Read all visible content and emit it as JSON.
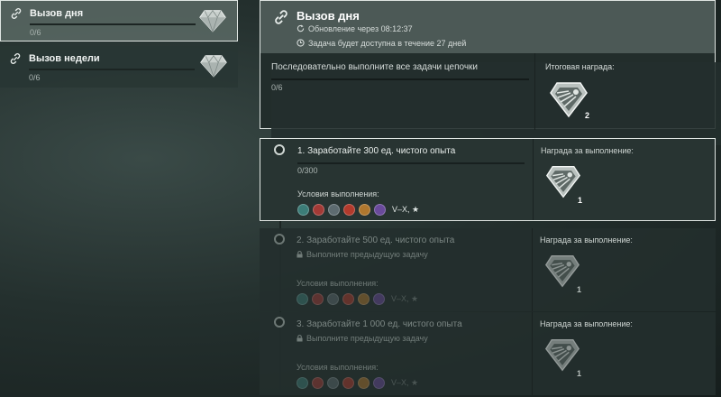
{
  "sidebar": {
    "cards": [
      {
        "title": "Вызов дня",
        "progress": "0/6",
        "selected": true
      },
      {
        "title": "Вызов недели",
        "progress": "0/6",
        "selected": false
      }
    ]
  },
  "header": {
    "title": "Вызов дня",
    "update": "Обновление через 08:12:37",
    "availability": "Задача будет доступна в течение 27 дней",
    "chain_text": "Последовательно выполните все задачи цепочки",
    "chain_progress": "0/6",
    "final_reward_label": "Итоговая награда:",
    "final_reward_count": "2"
  },
  "tasks": [
    {
      "title": "1. Заработайте 300 ед. чистого опыта",
      "progress": "0/300",
      "locked": false,
      "conditions_label": "Условия выполнения:",
      "tiers": "V–X, ★",
      "reward_label": "Награда за выполнение:",
      "reward_count": "1"
    },
    {
      "title": "2. Заработайте 500 ед. чистого опыта",
      "lock_text": "Выполните предыдущую задачу",
      "locked": true,
      "conditions_label": "Условия выполнения:",
      "tiers": "V–X, ★",
      "reward_label": "Награда за выполнение:",
      "reward_count": "1"
    },
    {
      "title": "3. Заработайте 1 000 ед. чистого опыта",
      "lock_text": "Выполните предыдущую задачу",
      "locked": true,
      "conditions_label": "Условия выполнения:",
      "tiers": "V–X, ★",
      "reward_label": "Награда за выполнение:",
      "reward_count": "1"
    }
  ],
  "condition_icons": [
    "destroyer-class-icon",
    "cruiser-class-icon",
    "battleship-class-icon",
    "aircraft-carrier-class-icon",
    "submarine-class-icon",
    "special-class-icon"
  ],
  "colors": {
    "accent_border": "#dfe5e2",
    "gem": "#d8dedb"
  }
}
